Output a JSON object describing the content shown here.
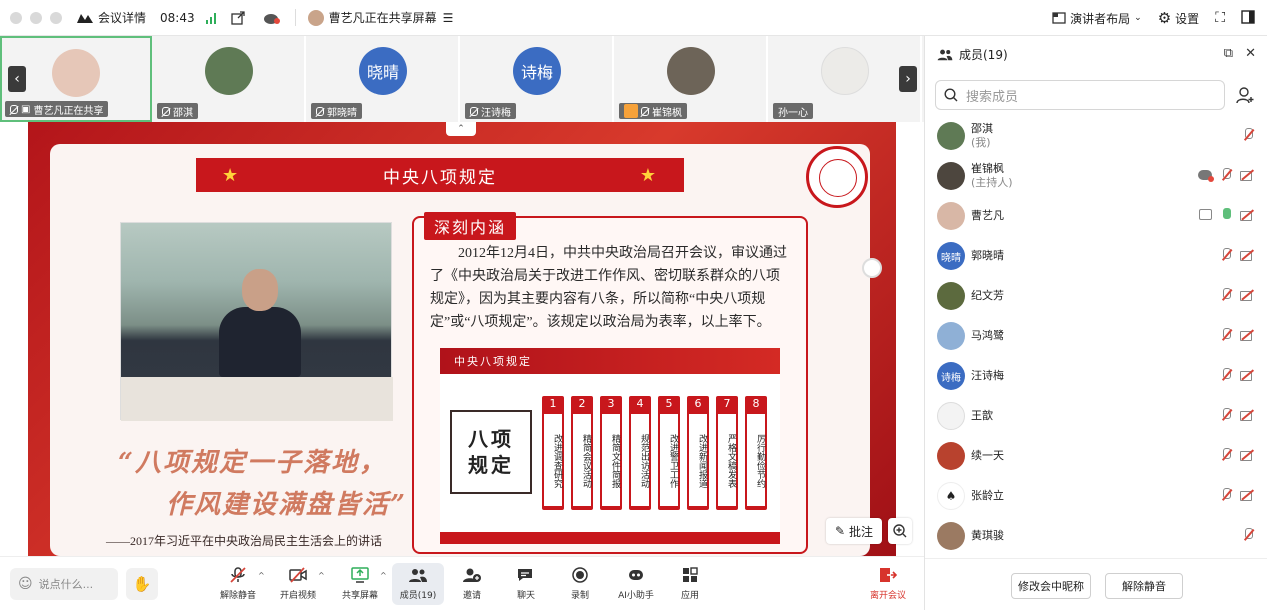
{
  "topbar": {
    "meeting_details": "会议详情",
    "time": "08:43",
    "sharing_status": "曹艺凡正在共享屏幕",
    "layout_label": "演讲者布局",
    "settings_label": "设置"
  },
  "strip": {
    "tiles": [
      {
        "name": "曹艺凡正在共享",
        "avatar_text": "",
        "avatar_color": "#e6c7b8",
        "host": false
      },
      {
        "name": "邵淇",
        "avatar_text": "",
        "avatar_color": "#5f7a55",
        "host": false
      },
      {
        "name": "郭晓晴",
        "avatar_text": "晓晴",
        "avatar_color": "#3b6cc2",
        "host": false
      },
      {
        "name": "汪诗梅",
        "avatar_text": "诗梅",
        "avatar_color": "#3b6cc2",
        "host": false
      },
      {
        "name": "崔锦枫",
        "avatar_text": "",
        "avatar_color": "#6d6458",
        "host": true
      },
      {
        "name": "孙一心",
        "avatar_text": "",
        "avatar_color": "#ecebe8",
        "host": false
      }
    ]
  },
  "slide": {
    "banner_title": "中央八项规定",
    "box_title": "深刻内涵",
    "deep_text": "2012年12月4日，中共中央政治局召开会议，审议通过了《中央政治局关于改进工作作风、密切联系群众的八项规定》，因为其主要内容有八条，所以简称“中央八项规定”或“八项规定”。该规定以政治局为表率，以上率下。",
    "rules_header": "中央八项规定",
    "ba_line1": "八项",
    "ba_line2": "规定",
    "rules": [
      {
        "num": "1",
        "text": "改进调查研究"
      },
      {
        "num": "2",
        "text": "精简会议活动"
      },
      {
        "num": "3",
        "text": "精简文件简报"
      },
      {
        "num": "4",
        "text": "规范出访活动"
      },
      {
        "num": "5",
        "text": "改进警卫工作"
      },
      {
        "num": "6",
        "text": "改进新闻报道"
      },
      {
        "num": "7",
        "text": "严格文稿发表"
      },
      {
        "num": "8",
        "text": "厉行勤俭节约"
      }
    ],
    "quote_line1": "“八项规定一子落地，",
    "quote_line2": "作风建设满盘皆活”",
    "quote_source": "——2017年习近平在中央政治局民主生活会上的讲话",
    "annotate_label": "批注"
  },
  "toolbar": {
    "say_placeholder": "说点什么...",
    "unmute": "解除静音",
    "start_video": "开启视频",
    "share_screen": "共享屏幕",
    "members": "成员(19)",
    "invite": "邀请",
    "chat": "聊天",
    "record": "录制",
    "ai_assistant": "AI小助手",
    "apps": "应用",
    "leave": "离开会议"
  },
  "panel": {
    "title": "成员(19)",
    "search_placeholder": "搜索成员",
    "members": [
      {
        "name": "邵淇",
        "sub": "(我)",
        "avatar_text": "",
        "avatar_color": "#5f7a55",
        "mic": "off",
        "cam": false,
        "share": false,
        "cloud": false
      },
      {
        "name": "崔锦枫",
        "sub": "(主持人)",
        "avatar_text": "",
        "avatar_color": "#4d463e",
        "mic": "off",
        "cam": true,
        "share": false,
        "cloud": true
      },
      {
        "name": "曹艺凡",
        "sub": "",
        "avatar_text": "",
        "avatar_color": "#d8b7a6",
        "mic": "on",
        "cam": true,
        "share": true,
        "cloud": false
      },
      {
        "name": "郭晓晴",
        "sub": "",
        "avatar_text": "晓晴",
        "avatar_color": "#3b6cc2",
        "mic": "off",
        "cam": true,
        "share": false,
        "cloud": false
      },
      {
        "name": "纪文芳",
        "sub": "",
        "avatar_text": "",
        "avatar_color": "#5c6a3e",
        "mic": "off",
        "cam": true,
        "share": false,
        "cloud": false
      },
      {
        "name": "马鸿鹭",
        "sub": "",
        "avatar_text": "",
        "avatar_color": "#8fb0d6",
        "mic": "off",
        "cam": true,
        "share": false,
        "cloud": false
      },
      {
        "name": "汪诗梅",
        "sub": "",
        "avatar_text": "诗梅",
        "avatar_color": "#3b6cc2",
        "mic": "off",
        "cam": true,
        "share": false,
        "cloud": false
      },
      {
        "name": "王歆",
        "sub": "",
        "avatar_text": "",
        "avatar_color": "#f3f3f3",
        "mic": "off",
        "cam": true,
        "share": false,
        "cloud": false
      },
      {
        "name": "续一天",
        "sub": "",
        "avatar_text": "",
        "avatar_color": "#b8422e",
        "mic": "off",
        "cam": true,
        "share": false,
        "cloud": false
      },
      {
        "name": "张龄立",
        "sub": "",
        "avatar_text": "",
        "avatar_color": "#ffffff",
        "mic": "off",
        "cam": true,
        "share": false,
        "cloud": false
      },
      {
        "name": "黄琪骏",
        "sub": "",
        "avatar_text": "",
        "avatar_color": "#9b7a62",
        "mic": "off",
        "cam": false,
        "share": false,
        "cloud": false
      }
    ],
    "rename_button": "修改会中昵称",
    "unmute_button": "解除静音"
  }
}
